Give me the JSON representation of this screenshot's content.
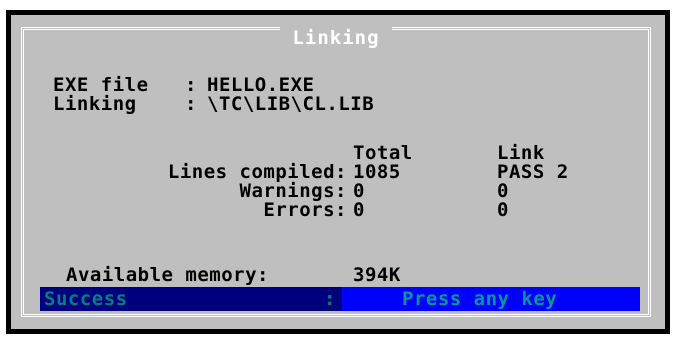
{
  "dialog": {
    "title": "Linking",
    "exe_label": "EXE file",
    "exe_sep": ":",
    "exe_value": "HELLO.EXE",
    "linking_label": "Linking",
    "linking_sep": ":",
    "linking_value": "\\TC\\LIB\\CL.LIB",
    "col_total": "Total",
    "col_link": "Link",
    "rows": [
      {
        "label": "Lines compiled:",
        "total": "1085",
        "link": "PASS 2"
      },
      {
        "label": "Warnings:",
        "total": "0",
        "link": "0"
      },
      {
        "label": "Errors:",
        "total": "0",
        "link": "0"
      }
    ],
    "memory_label": "Available memory:",
    "memory_value": "394K",
    "status_text": "Success",
    "status_sep": ":",
    "status_prompt": "Press any key"
  },
  "colors": {
    "panel": "#bfbfbf",
    "frame": "#ffffff",
    "status_left_bg": "#00007f",
    "status_right_bg": "#0000ff",
    "status_text": "#008080"
  }
}
